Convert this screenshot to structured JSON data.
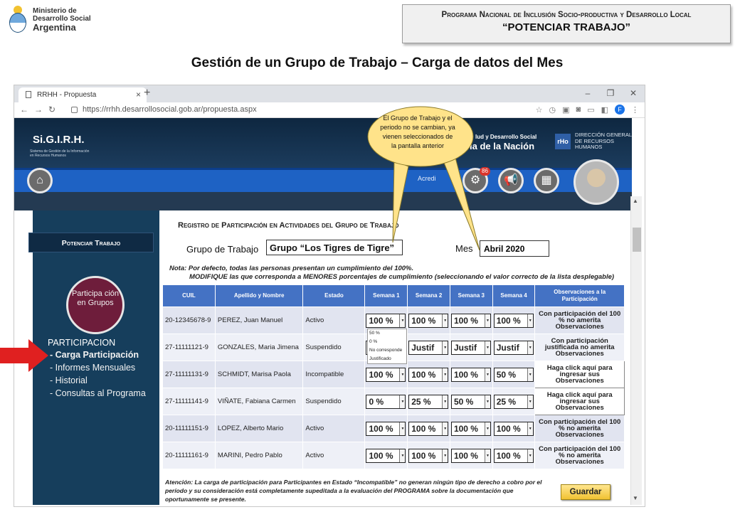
{
  "ministry": {
    "line1": "Ministerio de",
    "line2": "Desarrollo Social",
    "line3": "Argentina"
  },
  "program": {
    "line1": "Programa Nacional de Inclusión Socio-productiva y Desarrollo Local",
    "line2": "“POTENCIAR TRABAJO”"
  },
  "slide_title": "Gestión de un Grupo de Trabajo – Carga de datos del Mes",
  "browser": {
    "tab_title": "RRHH - Propuesta",
    "tab_close": "×",
    "new_tab": "+",
    "url": "https://rrhh.desarrollosocial.gob.ar/propuesta.aspx",
    "window_controls": [
      "–",
      "❐",
      "✕"
    ],
    "profile_initial": "F"
  },
  "app": {
    "logo": "Si.G.I.R.H.",
    "logo_sub": "Sistema de Gestión de la Información en Recursos Humanos",
    "ministry_line1": "lud y Desarrollo Social",
    "ministry_line2": "ia de la Nación",
    "rho": "rHo",
    "dg_line1": "DIRECCIÓN GENERAL",
    "dg_line2": "DE RECURSOS",
    "dg_line3": "HUMANOS",
    "acred": "Acredi",
    "badge": "86"
  },
  "callout": "El Grupo de Trabajo y el periodo no se cambian, ya vienen seleccionados de la pantalla anterior",
  "sidebar": {
    "box_label": "Potenciar Trabajo",
    "circle_label": "Participa ción en Grupos",
    "menu_title": "PARTICIPACION",
    "items": [
      "- Carga Participación",
      "- Informes Mensuales",
      "- Historial",
      "- Consultas al Programa"
    ]
  },
  "form": {
    "section_title": "Registro de Participación en Actividades del Grupo de Trabajo",
    "grupo_label": "Grupo de Trabajo",
    "grupo_value": "Grupo “Los Tigres de Tigre”",
    "mes_label": "Mes",
    "mes_value": "Abril 2020",
    "nota1": "Nota: Por defecto, todas las personas presentan un cumplimiento del 100%.",
    "nota2": "MODIFIQUE las que corresponda a MENORES porcentajes de cumplimiento (seleccionando el valor correcto de la lista desplegable)"
  },
  "table": {
    "headers": [
      "CUIL",
      "Apellido y Nombre",
      "Estado",
      "Semana 1",
      "Semana 2",
      "Semana 3",
      "Semana 4",
      "Observaciones a la Participación"
    ],
    "rows": [
      {
        "cuil": "20-12345678-9",
        "nombre": "PEREZ, Juan Manuel",
        "estado": "Activo",
        "s1": "100 %",
        "s2": "100 %",
        "s3": "100 %",
        "s4": "100 %",
        "obs": "Con participación del 100 % no amerita Observaciones"
      },
      {
        "cuil": "27-11111121-9",
        "nombre": "GONZALES, Maria Jimena",
        "estado": "Suspendido",
        "s1": "",
        "s2": "Justif",
        "s3": "Justif",
        "s4": "Justif",
        "obs": "Con participación justificada no amerita Observaciones"
      },
      {
        "cuil": "27-11111131-9",
        "nombre": "SCHMIDT, Marisa Paola",
        "estado": "Incompatible",
        "s1": "100 %",
        "s2": "100 %",
        "s3": "100 %",
        "s4": "50 %",
        "obs": "Haga click aquí para ingresar sus Observaciones"
      },
      {
        "cuil": "27-11111141-9",
        "nombre": "VIÑATE, Fabiana Carmen",
        "estado": "Suspendido",
        "s1": "0 %",
        "s2": "25 %",
        "s3": "50 %",
        "s4": "25 %",
        "obs": "Haga click aquí para ingresar sus Observaciones"
      },
      {
        "cuil": "20-11111151-9",
        "nombre": "LOPEZ, Alberto Mario",
        "estado": "Activo",
        "s1": "100 %",
        "s2": "100 %",
        "s3": "100 %",
        "s4": "100 %",
        "obs": "Con participación del 100 % no amerita Observaciones"
      },
      {
        "cuil": "20-11111161-9",
        "nombre": "MARINI, Pedro Pablo",
        "estado": "Activo",
        "s1": "100 %",
        "s2": "100 %",
        "s3": "100 %",
        "s4": "100 %",
        "obs": "Con participación del 100 % no amerita Observaciones"
      }
    ],
    "dropdown_options": [
      "50 %",
      "0 %",
      "No corresponde",
      "Justificado"
    ]
  },
  "atencion": "Atención: La carga de participación para Participantes en Estado “Incompatible” no generan ningún tipo de derecho a cobro por el período y su consideración está completamente supeditada a la evaluación del PROGRAMA sobre la documentación que oportunamente se presente.",
  "guardar_label": "Guardar"
}
